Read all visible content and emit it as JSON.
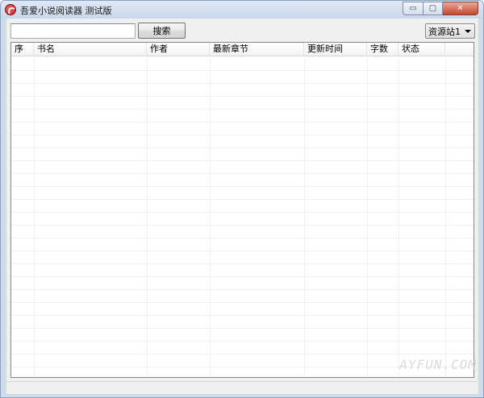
{
  "window": {
    "title": "吾爱小说阅读器 测试版",
    "icon": "app-logo-icon",
    "controls": {
      "minimize": "▭",
      "maximize": "▢",
      "close": "✕"
    }
  },
  "toolbar": {
    "search_value": "",
    "search_placeholder": "",
    "search_button_label": "搜索",
    "source_select_value": "资源站1"
  },
  "table": {
    "columns": [
      "序",
      "书名",
      "作者",
      "最新章节",
      "更新时间",
      "字数",
      "状态"
    ],
    "rows": []
  },
  "watermark": "AYFUN.COM"
}
